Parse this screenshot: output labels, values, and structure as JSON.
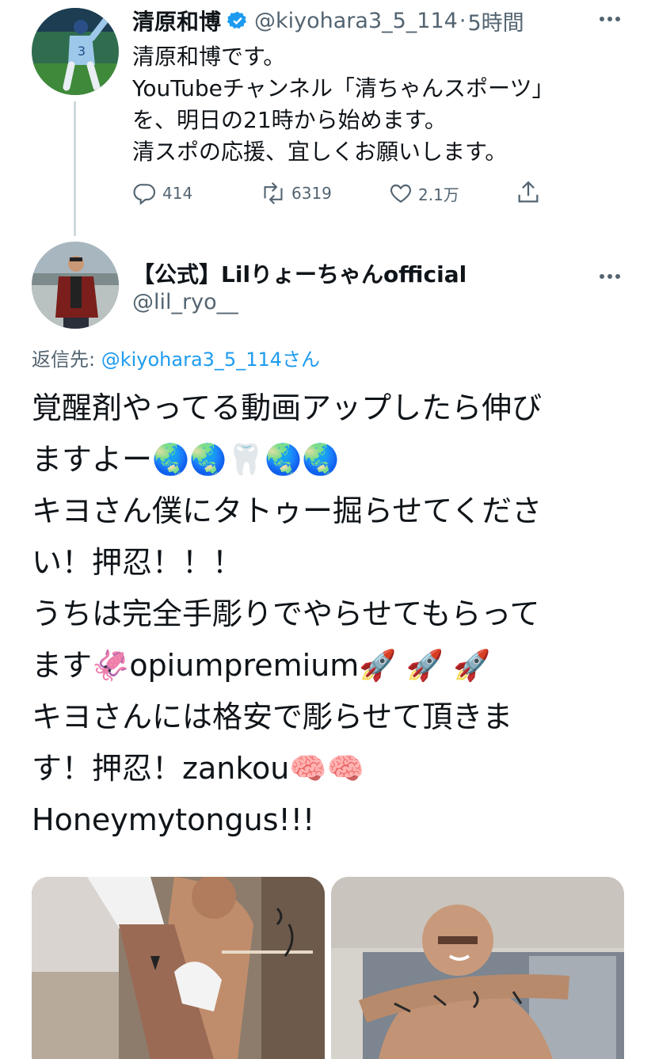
{
  "tweet": {
    "author_name": "清原和博",
    "handle": "@kiyohara3_5_114",
    "separator": "·",
    "time": "5時間",
    "text_lines": [
      "清原和博です。",
      "YouTubeチャンネル「清ちゃんスポーツ」",
      "を、明日の21時から始めます。",
      "清スポの応援、宜しくお願いします。"
    ],
    "reply_count": "414",
    "retweet_count": "6319",
    "like_count": "2.1万"
  },
  "reply": {
    "author_name": "【公式】Lilりょーちゃんofficial",
    "handle": "@lil_ryo__",
    "reply_to_prefix": "返信先: ",
    "reply_to_handle": "@kiyohara3_5_114さん",
    "text": "覚醒剤やってる動画アップしたら伸び\nますよー🌏🌏🦷🌏🌏\nキヨさん僕にタトゥー掘らせてくださ\nい！押忍！！！\nうちは完全手彫りでやらせてもらって\nます🦑opiumpremium🚀 🚀 🚀\nキヨさんには格安で彫らせて頂きま\nす！押忍！zankou🧠🧠\nHoneymytongus!!!"
  },
  "icons": [
    "verified-badge-icon",
    "more-icon",
    "reply-icon",
    "retweet-icon",
    "like-icon",
    "share-icon"
  ],
  "colors": {
    "accent": "#1d9bf0",
    "secondary_text": "#536471",
    "thread_line": "#cfd9de"
  }
}
